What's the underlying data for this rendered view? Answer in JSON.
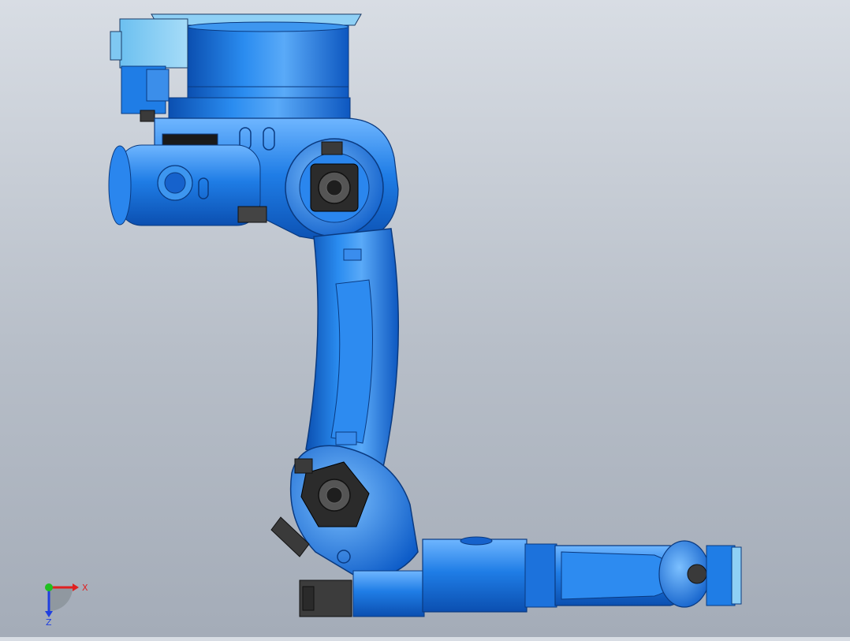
{
  "viewport": {
    "background_top": "#d8dde4",
    "background_bottom": "#a4acb8",
    "model": {
      "name": "robot-arm-assembly",
      "body_color": "#1f7de6",
      "body_dark": "#0b4fb0",
      "body_light": "#6fb6ff",
      "housing_color": "#8fd0f5",
      "motor_color": "#3a3a3a"
    }
  },
  "triad": {
    "x_label": "X",
    "z_label": "Z",
    "x_color": "#e02020",
    "y_color": "#20c020",
    "z_color": "#2040e0"
  }
}
